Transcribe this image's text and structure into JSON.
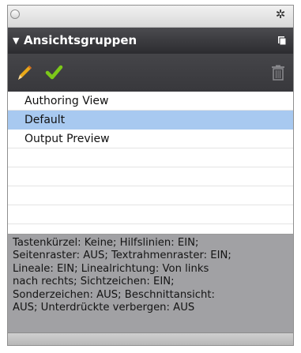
{
  "panel": {
    "header": {
      "title": "Ansichtsgruppen",
      "collapse_icon": "triangle-down",
      "menu_icon": "panel-menu-icon"
    },
    "titlebar_icons": [
      "close-circle-icon",
      "gear-icon"
    ],
    "toolbar": {
      "tools": [
        {
          "name": "edit",
          "icon": "pencil-icon"
        },
        {
          "name": "apply",
          "icon": "checkmark-icon"
        },
        {
          "name": "delete",
          "icon": "trash-icon"
        }
      ]
    },
    "list": {
      "items": [
        {
          "label": "Authoring View",
          "selected": false
        },
        {
          "label": "Default",
          "selected": true
        },
        {
          "label": "Output Preview",
          "selected": false
        }
      ]
    },
    "info": {
      "lines": [
        "Tastenkürzel: Keine; Hilfslinien: EIN;",
        "Seitenraster: AUS;  Textrahmenraster: EIN;",
        "Lineale: EIN;  Linealrichtung:  Von links",
        "nach rechts;  Sichtzeichen: EIN;",
        "Sonderzeichen: AUS;  Beschnittansicht:",
        "AUS;  Unterdrückte verbergen: AUS"
      ]
    }
  },
  "colors": {
    "header_bg": "#333337",
    "toolbar_bg": "#3e3e42",
    "selection": "#a8c9f0",
    "info_bg": "#a1a1a4",
    "pencil": "#e9a91a",
    "check": "#7cc819"
  }
}
